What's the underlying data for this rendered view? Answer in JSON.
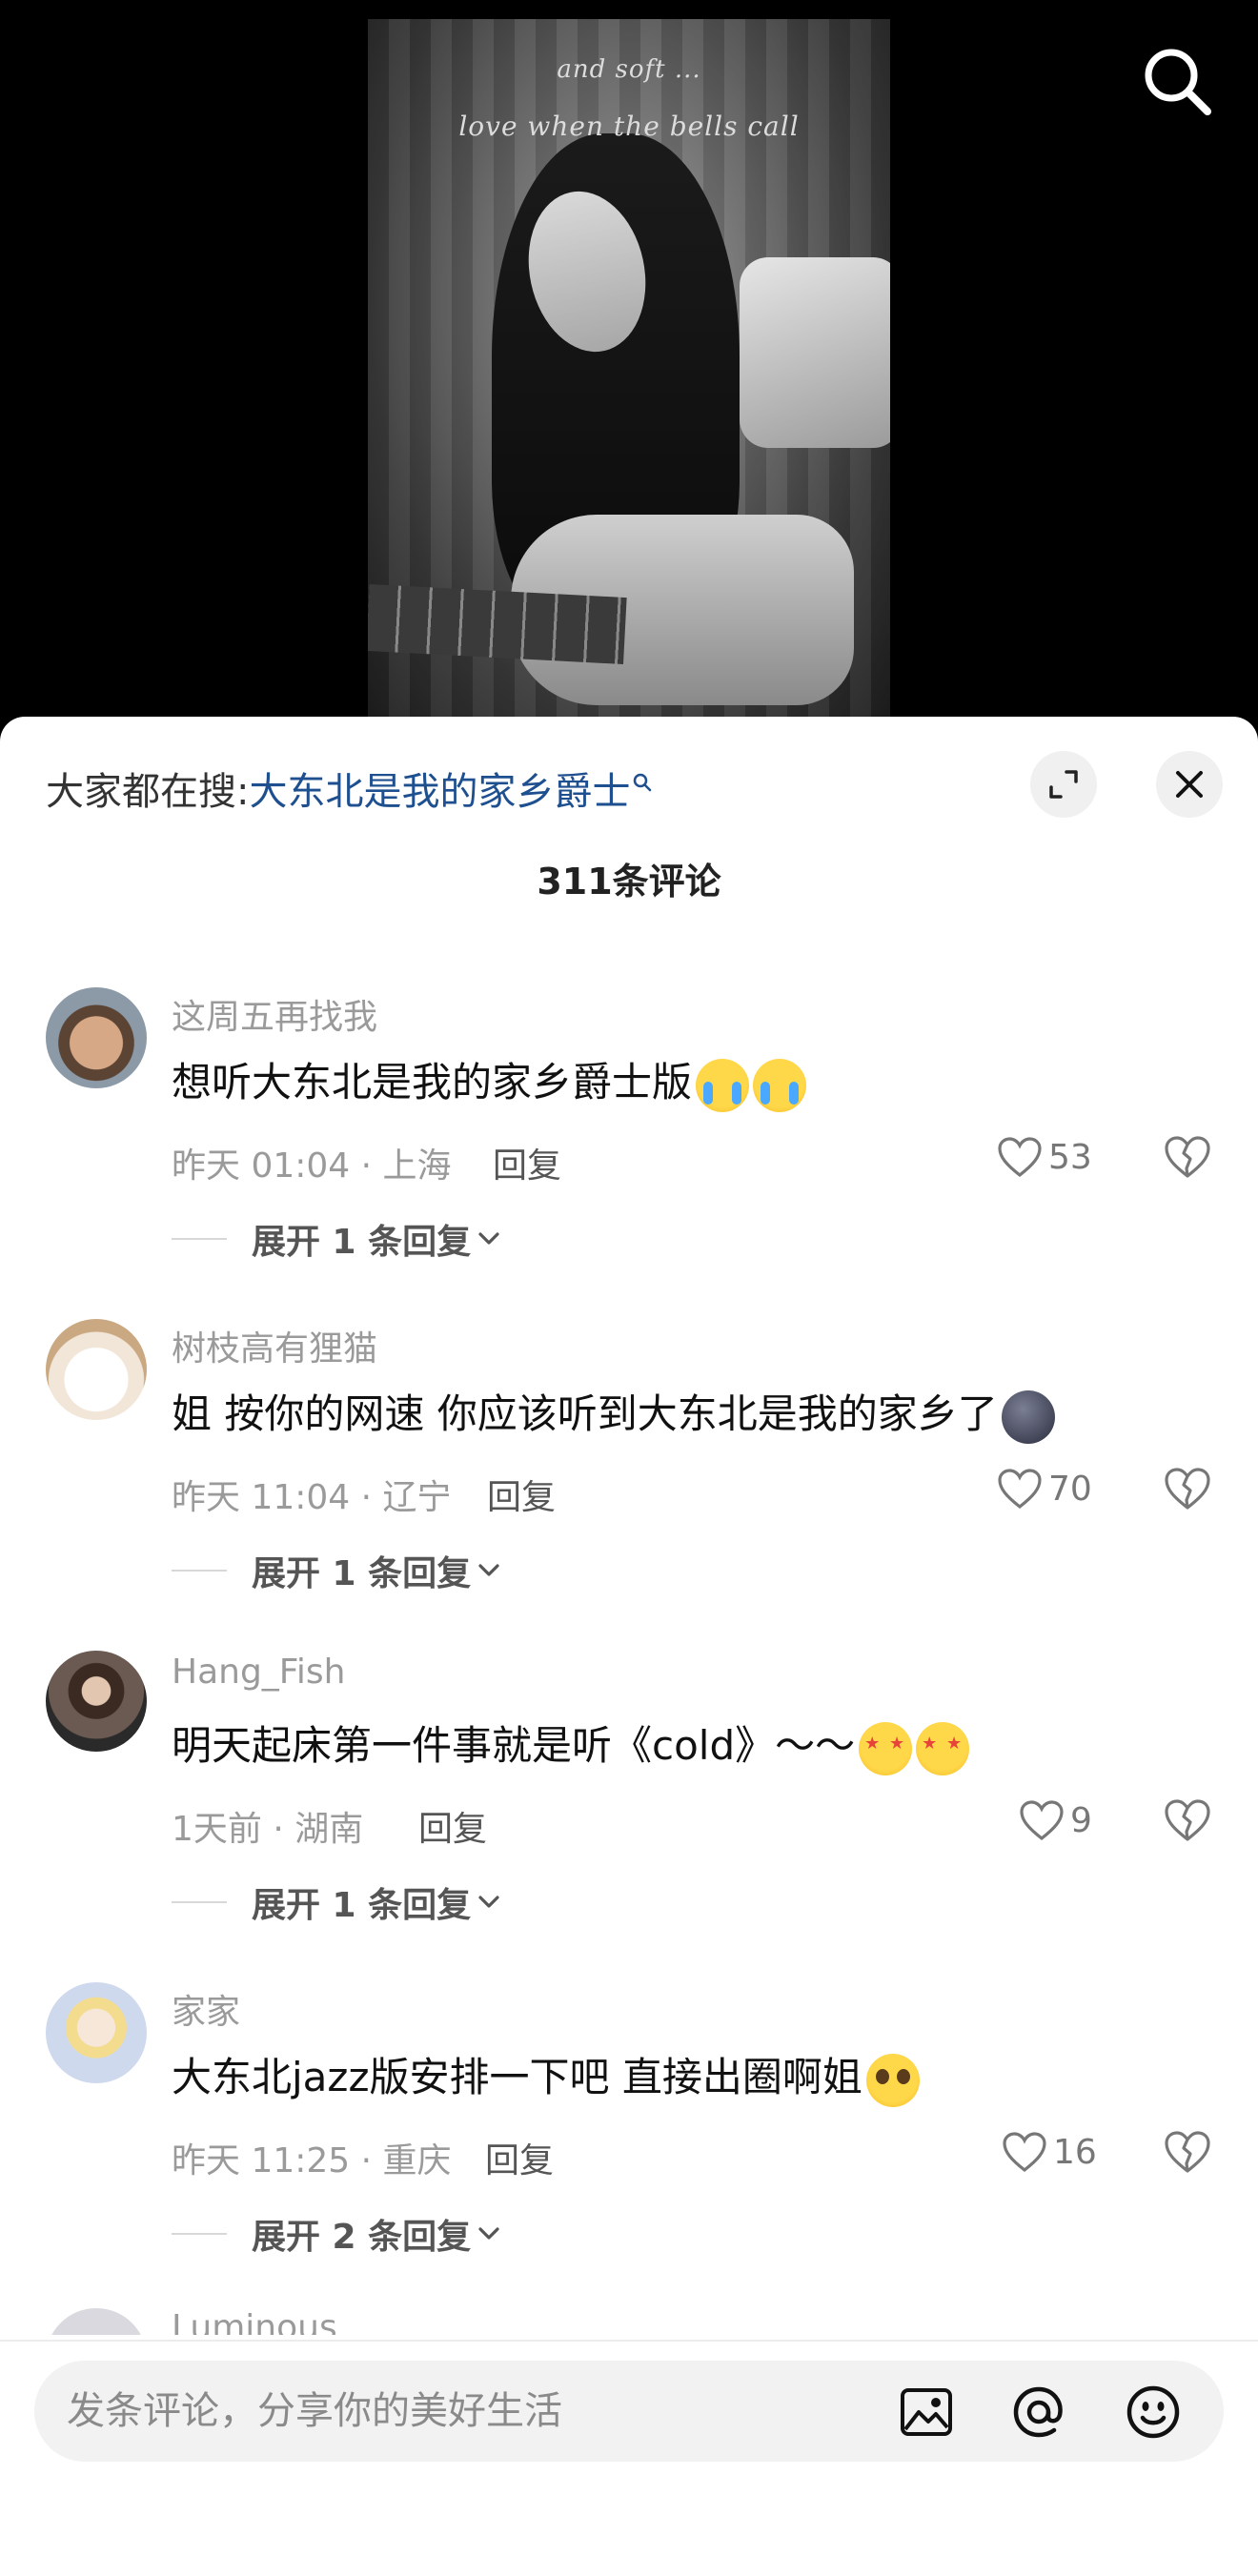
{
  "video": {
    "lyric_line1": "and soft ...",
    "lyric_line2": "love when the bells call"
  },
  "sheet": {
    "hot_search_prefix": "大家都在搜:",
    "hot_search_term": "大东北是我的家乡爵士",
    "comment_count": "311条评论"
  },
  "comments": [
    {
      "username": "这周五再找我",
      "text": "想听大东北是我的家乡爵士版",
      "emojis": [
        "cry",
        "cry"
      ],
      "meta": "昨天 01:04 · 上海",
      "reply_label": "回复",
      "likes": "53",
      "expand_label": "展开 1 条回复"
    },
    {
      "username": "树枝高有狸猫",
      "text": "姐 按你的网速 你应该听到大东北是我的家乡了",
      "emojis": [
        "moon"
      ],
      "meta": "昨天 11:04 · 辽宁",
      "reply_label": "回复",
      "likes": "70",
      "expand_label": "展开 1 条回复"
    },
    {
      "username": "Hang_Fish",
      "text": "明天起床第一件事就是听《cold》～～",
      "emojis": [
        "star",
        "star"
      ],
      "meta": "1天前 · 湖南",
      "reply_label": "回复",
      "likes": "9",
      "expand_label": "展开 1 条回复"
    },
    {
      "username": "家家",
      "text": "大东北jazz版安排一下吧 直接出圈啊姐",
      "emojis": [
        "plead"
      ],
      "meta": "昨天 11:25 · 重庆",
      "reply_label": "回复",
      "likes": "16",
      "expand_label": "展开 2 条回复"
    }
  ],
  "partial_comment": {
    "username": "Luminous"
  },
  "input": {
    "placeholder": "发条评论，分享你的美好生活"
  },
  "icons": {
    "search": "search-icon",
    "expand": "expand-icon",
    "close": "close-icon",
    "like": "heart-icon",
    "dislike": "broken-heart-icon",
    "chevron": "chevron-down-icon",
    "image": "image-icon",
    "mention": "at-icon",
    "emoji": "emoji-icon"
  },
  "colors": {
    "link": "#1e4f8f",
    "muted": "#9a9a9a"
  }
}
